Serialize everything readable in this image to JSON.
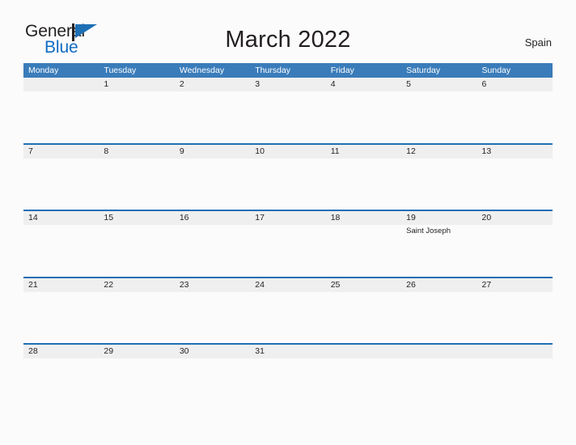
{
  "brand": {
    "name_top": "General",
    "name_bottom": "Blue",
    "flag_icon": "flag-icon",
    "accent_color": "#1f6fb5",
    "text_color": "#231f20"
  },
  "header": {
    "title": "March 2022",
    "country": "Spain"
  },
  "calendar": {
    "header_bg": "#3a7cba",
    "band_bg": "#efefef",
    "rule_color": "#1f6fb5",
    "weekdays": [
      "Monday",
      "Tuesday",
      "Wednesday",
      "Thursday",
      "Friday",
      "Saturday",
      "Sunday"
    ],
    "weeks": [
      [
        {
          "day": "",
          "event": ""
        },
        {
          "day": "1",
          "event": ""
        },
        {
          "day": "2",
          "event": ""
        },
        {
          "day": "3",
          "event": ""
        },
        {
          "day": "4",
          "event": ""
        },
        {
          "day": "5",
          "event": ""
        },
        {
          "day": "6",
          "event": ""
        }
      ],
      [
        {
          "day": "7",
          "event": ""
        },
        {
          "day": "8",
          "event": ""
        },
        {
          "day": "9",
          "event": ""
        },
        {
          "day": "10",
          "event": ""
        },
        {
          "day": "11",
          "event": ""
        },
        {
          "day": "12",
          "event": ""
        },
        {
          "day": "13",
          "event": ""
        }
      ],
      [
        {
          "day": "14",
          "event": ""
        },
        {
          "day": "15",
          "event": ""
        },
        {
          "day": "16",
          "event": ""
        },
        {
          "day": "17",
          "event": ""
        },
        {
          "day": "18",
          "event": ""
        },
        {
          "day": "19",
          "event": "Saint Joseph"
        },
        {
          "day": "20",
          "event": ""
        }
      ],
      [
        {
          "day": "21",
          "event": ""
        },
        {
          "day": "22",
          "event": ""
        },
        {
          "day": "23",
          "event": ""
        },
        {
          "day": "24",
          "event": ""
        },
        {
          "day": "25",
          "event": ""
        },
        {
          "day": "26",
          "event": ""
        },
        {
          "day": "27",
          "event": ""
        }
      ],
      [
        {
          "day": "28",
          "event": ""
        },
        {
          "day": "29",
          "event": ""
        },
        {
          "day": "30",
          "event": ""
        },
        {
          "day": "31",
          "event": ""
        },
        {
          "day": "",
          "event": ""
        },
        {
          "day": "",
          "event": ""
        },
        {
          "day": "",
          "event": ""
        }
      ]
    ]
  }
}
